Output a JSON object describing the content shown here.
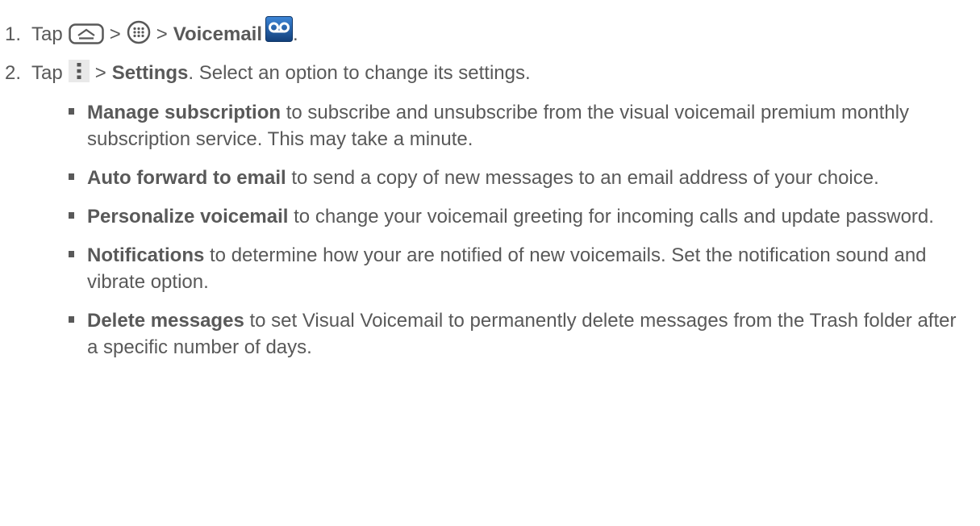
{
  "steps": [
    {
      "number": "1.",
      "tap": "Tap",
      "sep1": ">",
      "sep2": ">",
      "target": "Voicemail",
      "end": "."
    },
    {
      "number": "2.",
      "tap": "Tap",
      "sep1": ">",
      "target": "Settings",
      "rest": ". Select an option to change its settings."
    }
  ],
  "options": [
    {
      "title": "Manage subscription",
      "desc": " to subscribe and unsubscribe from the visual voicemail premium monthly subscription service. This may take a minute."
    },
    {
      "title": "Auto forward to email",
      "desc": " to send a copy of new messages to an email address of your choice."
    },
    {
      "title": "Personalize voicemail",
      "desc": " to change your voicemail greeting for incoming calls and update password."
    },
    {
      "title": "Notifications",
      "desc": " to determine how your are notified of new voicemails. Set the notification sound and vibrate option."
    },
    {
      "title": "Delete messages",
      "desc": " to set Visual Voicemail to permanently delete messages from the Trash folder after a specific number of days."
    }
  ],
  "icons": {
    "home": "home-icon",
    "apps": "apps-icon",
    "voicemail": "voicemail-app-icon",
    "menu": "menu-icon"
  },
  "colors": {
    "text": "#595959",
    "voicemail_icon": "#1f5ea8"
  }
}
